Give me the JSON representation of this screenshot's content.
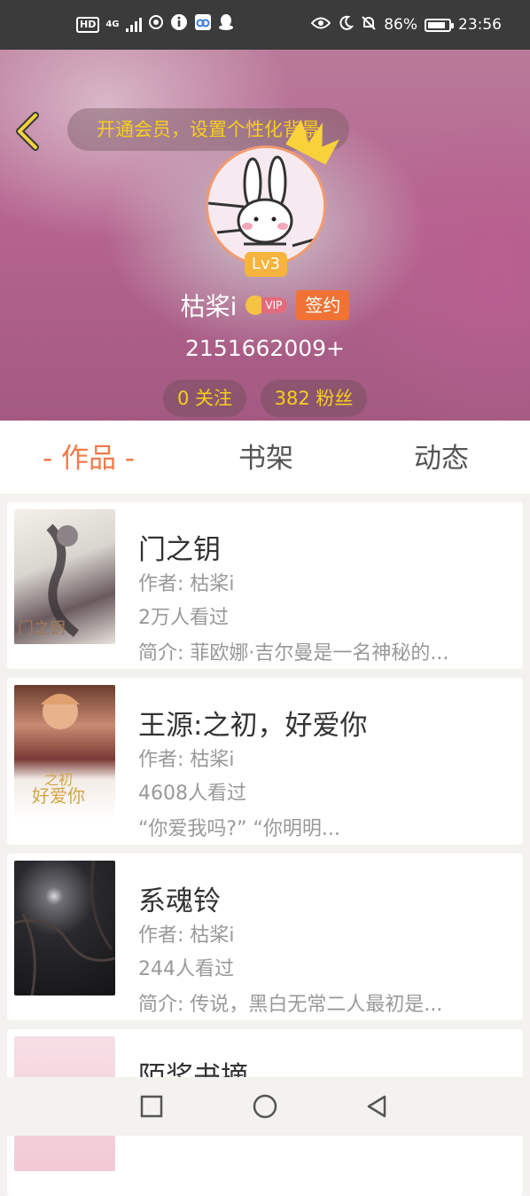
{
  "status_bar": {
    "left_icons": [
      "hd-icon",
      "4g-signal-icon",
      "app-swirl-icon",
      "info-icon",
      "cloud-app-icon",
      "qq-icon"
    ],
    "hd": "HD",
    "net": "4G",
    "battery": "86%",
    "time": "23:56"
  },
  "header": {
    "banner": "开通会员，设置个性化背景",
    "level": "Lv3",
    "name": "枯桨i",
    "vip": "VIP",
    "sign": "签约",
    "uid": "2151662009+",
    "following": "0 关注",
    "fans": "382 粉丝"
  },
  "tabs": [
    {
      "label": "- 作品 -",
      "active": true
    },
    {
      "label": "书架",
      "active": false
    },
    {
      "label": "动态",
      "active": false
    }
  ],
  "works": [
    {
      "title": "门之钥",
      "author": "作者: 枯桨i",
      "views": "2万人看过",
      "desc": "简介: 菲欧娜·吉尔曼是一名神秘的..."
    },
    {
      "title": "王源:之初，好爱你",
      "author": "作者: 枯桨i",
      "views": "4608人看过",
      "desc": "“你爱我吗?” “你明明..."
    },
    {
      "title": "系魂铃",
      "author": "作者: 枯桨i",
      "views": "244人看过",
      "desc": "简介: 传说，黑白无常二人最初是..."
    },
    {
      "title": "陌桨书摘"
    }
  ],
  "colors": {
    "accent": "#f07a4a",
    "gold": "#f7cf1c",
    "sign": "#f07235"
  }
}
